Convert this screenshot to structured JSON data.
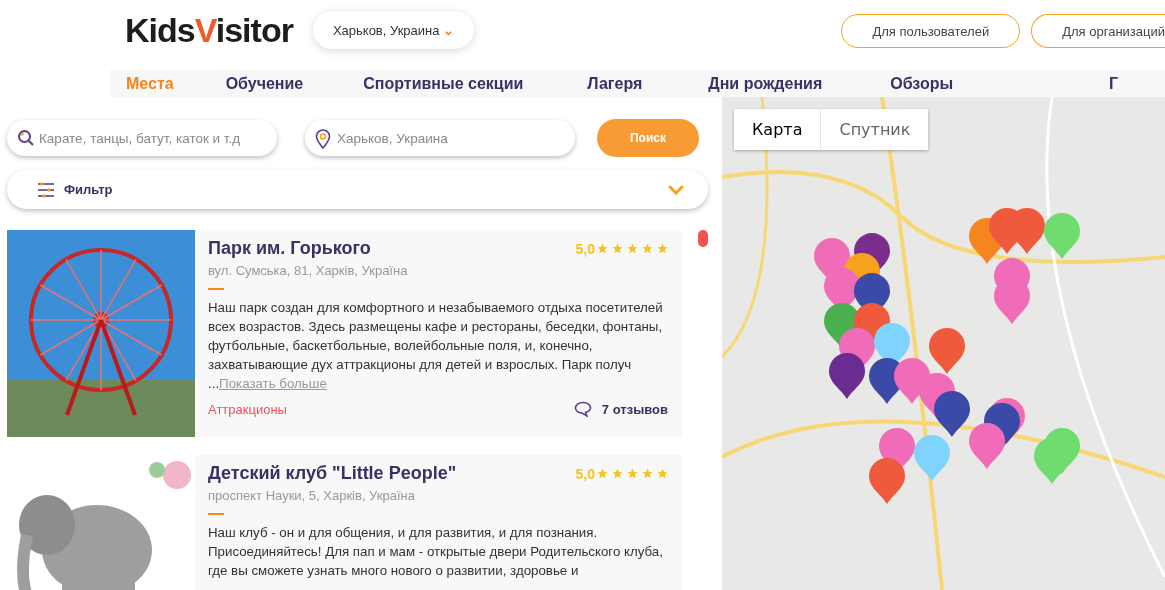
{
  "header": {
    "logo": {
      "part_1": "Kids",
      "part_2": "V",
      "part_3": "isitor"
    },
    "city_select": {
      "value": "Харьков, Украина",
      "caret": "⌄"
    },
    "buttons": [
      "Для пользователей",
      "Для организаций"
    ]
  },
  "nav": [
    {
      "label": "Места",
      "selected": true
    },
    {
      "label": "Обучение",
      "selected": false
    },
    {
      "label": "Спортивные секции",
      "selected": false
    },
    {
      "label": "Лагеря",
      "selected": false
    },
    {
      "label": "Дни рождения",
      "selected": false
    },
    {
      "label": "Обзоры",
      "selected": false
    },
    {
      "label": "Г",
      "selected": false
    }
  ],
  "search": {
    "query_placeholder": "Карате, танцы, батут, каток и т.д",
    "location_placeholder": "Харьков, Украина",
    "button": "Поиск"
  },
  "filter": {
    "label": "Фильтр",
    "expanded": false
  },
  "places": [
    {
      "kind": "ferris",
      "title": "Парк им. Горького",
      "address": "вул. Сумська, 81, Харків, Україна",
      "rating": "5,0",
      "stars": 5,
      "description": "Наш парк создан для комфортного и незабываемого отдыха посетителей всех возрастов. Здесь размещены кафе и рестораны, беседки, фонтаны, футбольные, баскетбольные, волейбольные поля, и, конечно, захватывающие дух аттракционы для детей и взрослых. Парк получ ...",
      "more_link": "Показать больше",
      "category": "Аттракционы",
      "reviews": "7 отзывов"
    },
    {
      "kind": "elephant",
      "title": "Детский клуб \"Little People\"",
      "address": "проспект Науки, 5, Харків, Україна",
      "rating": "5,0",
      "stars": 5,
      "description": "Наш клуб - он и для общения, и для развития, и для познания. Присоединяйтесь! Для пап и мам - открытые двери Родительского клуба, где вы сможете узнать много нового о развитии, здоровье и"
    }
  ],
  "map": {
    "types": [
      {
        "label": "Карта",
        "selected": true
      },
      {
        "label": "Спутник",
        "selected": false
      }
    ]
  }
}
